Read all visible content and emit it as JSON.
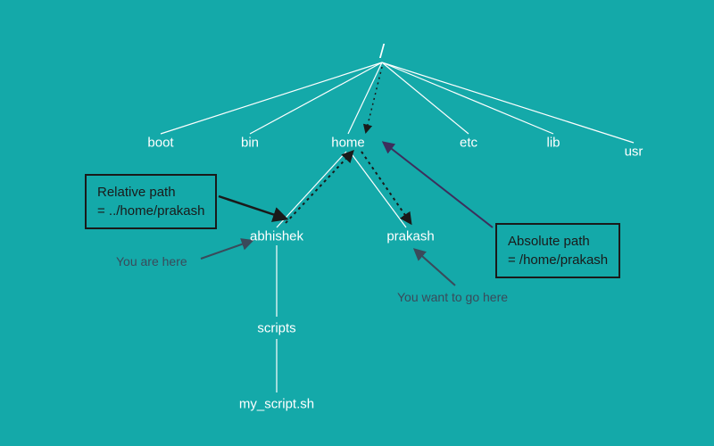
{
  "nodes": {
    "root": "/",
    "boot": "boot",
    "bin": "bin",
    "home": "home",
    "etc": "etc",
    "lib": "lib",
    "usr": "usr",
    "abhishek": "abhishek",
    "prakash": "prakash",
    "scripts": "scripts",
    "myscript": "my_script.sh"
  },
  "labels": {
    "relative_path_l1": "Relative path",
    "relative_path_l2": "= ../home/prakash",
    "absolute_path_l1": "Absolute path",
    "absolute_path_l2": "= /home/prakash",
    "you_are_here": "You are here",
    "you_want": "You want to go here"
  },
  "chart_data": {
    "type": "tree",
    "title": "Filesystem path diagram (absolute vs relative)",
    "root": "/",
    "edges": [
      [
        "/",
        "boot"
      ],
      [
        "/",
        "bin"
      ],
      [
        "/",
        "home"
      ],
      [
        "/",
        "etc"
      ],
      [
        "/",
        "lib"
      ],
      [
        "/",
        "usr"
      ],
      [
        "home",
        "abhishek"
      ],
      [
        "home",
        "prakash"
      ],
      [
        "abhishek",
        "scripts"
      ],
      [
        "scripts",
        "my_script.sh"
      ]
    ],
    "current_location": "abhishek",
    "target_location": "prakash",
    "relative_path": "../home/prakash",
    "absolute_path": "/home/prakash",
    "annotations": [
      {
        "text": "You are here",
        "points_to": "abhishek"
      },
      {
        "text": "You want to go here",
        "points_to": "prakash"
      },
      {
        "text": "Relative path = ../home/prakash",
        "type": "dotted-arrows",
        "from": "abhishek",
        "via": "home",
        "to": "prakash"
      },
      {
        "text": "Absolute path = /home/prakash",
        "type": "solid-arrow",
        "from": "/",
        "to": "prakash"
      }
    ]
  }
}
